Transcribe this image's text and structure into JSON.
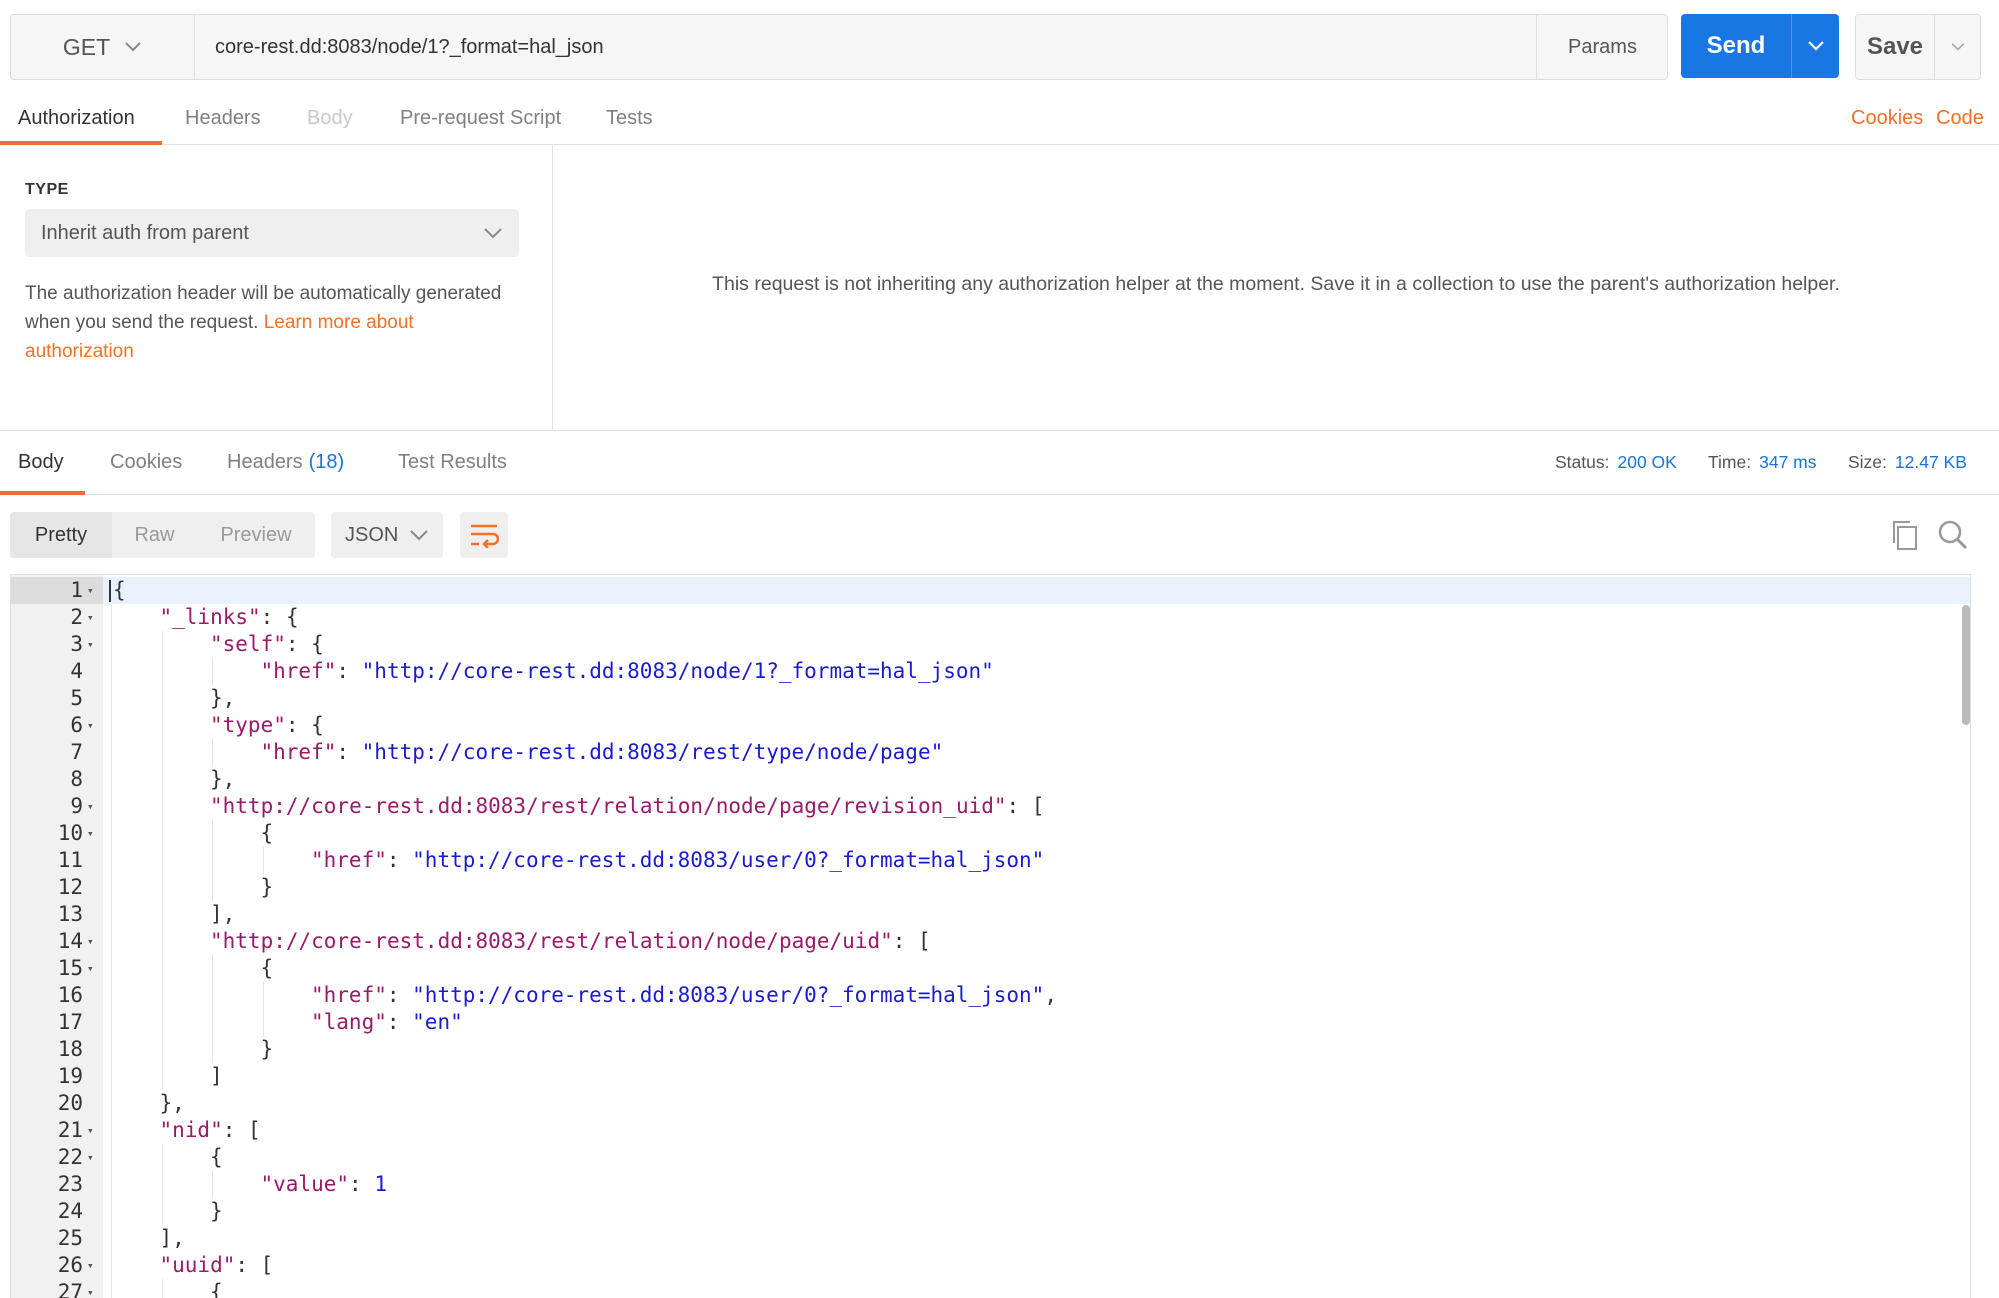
{
  "request": {
    "method": "GET",
    "url": "core-rest.dd:8083/node/1?_format=hal_json",
    "params_label": "Params",
    "send_label": "Send",
    "save_label": "Save"
  },
  "request_tabs": [
    {
      "label": "Authorization"
    },
    {
      "label": "Headers"
    },
    {
      "label": "Body"
    },
    {
      "label": "Pre-request Script"
    },
    {
      "label": "Tests"
    }
  ],
  "request_links": {
    "cookies": "Cookies",
    "code": "Code"
  },
  "auth": {
    "type_label": "TYPE",
    "type_value": "Inherit auth from parent",
    "description": "The authorization header will be automatically generated when you send the request.",
    "learn_more": "Learn more about authorization",
    "message": "This request is not inheriting any authorization helper at the moment. Save it in a collection to use the parent's authorization helper."
  },
  "response_tabs": [
    {
      "label": "Body"
    },
    {
      "label": "Cookies"
    },
    {
      "label": "Headers",
      "badge": "(18)"
    },
    {
      "label": "Test Results"
    }
  ],
  "status": {
    "status_label": "Status:",
    "status_value": "200 OK",
    "time_label": "Time:",
    "time_value": "347 ms",
    "size_label": "Size:",
    "size_value": "12.47 KB"
  },
  "body_view": {
    "modes": [
      "Pretty",
      "Raw",
      "Preview"
    ],
    "language": "JSON"
  },
  "icons": {
    "wrap": "wrap-lines-icon",
    "copy": "copy-icon",
    "search": "search-icon",
    "accent_color": "#f47023",
    "send_color": "#1877e3",
    "link_blue": "#1a73d9"
  },
  "code_lines": [
    {
      "n": "1",
      "fold": true,
      "indent": 0,
      "tokens": [
        {
          "t": "p",
          "v": "{"
        }
      ]
    },
    {
      "n": "2",
      "fold": true,
      "indent": 1,
      "tokens": [
        {
          "t": "k",
          "v": "\"_links\""
        },
        {
          "t": "p",
          "v": ": {"
        }
      ]
    },
    {
      "n": "3",
      "fold": true,
      "indent": 2,
      "tokens": [
        {
          "t": "k",
          "v": "\"self\""
        },
        {
          "t": "p",
          "v": ": {"
        }
      ]
    },
    {
      "n": "4",
      "fold": false,
      "indent": 3,
      "tokens": [
        {
          "t": "k",
          "v": "\"href\""
        },
        {
          "t": "p",
          "v": ": "
        },
        {
          "t": "s",
          "v": "\"http://core-rest.dd:8083/node/1?_format=hal_json\""
        }
      ]
    },
    {
      "n": "5",
      "fold": false,
      "indent": 2,
      "tokens": [
        {
          "t": "p",
          "v": "},"
        }
      ]
    },
    {
      "n": "6",
      "fold": true,
      "indent": 2,
      "tokens": [
        {
          "t": "k",
          "v": "\"type\""
        },
        {
          "t": "p",
          "v": ": {"
        }
      ]
    },
    {
      "n": "7",
      "fold": false,
      "indent": 3,
      "tokens": [
        {
          "t": "k",
          "v": "\"href\""
        },
        {
          "t": "p",
          "v": ": "
        },
        {
          "t": "s",
          "v": "\"http://core-rest.dd:8083/rest/type/node/page\""
        }
      ]
    },
    {
      "n": "8",
      "fold": false,
      "indent": 2,
      "tokens": [
        {
          "t": "p",
          "v": "},"
        }
      ]
    },
    {
      "n": "9",
      "fold": true,
      "indent": 2,
      "tokens": [
        {
          "t": "k",
          "v": "\"http://core-rest.dd:8083/rest/relation/node/page/revision_uid\""
        },
        {
          "t": "p",
          "v": ": ["
        }
      ]
    },
    {
      "n": "10",
      "fold": true,
      "indent": 3,
      "tokens": [
        {
          "t": "p",
          "v": "{"
        }
      ]
    },
    {
      "n": "11",
      "fold": false,
      "indent": 4,
      "tokens": [
        {
          "t": "k",
          "v": "\"href\""
        },
        {
          "t": "p",
          "v": ": "
        },
        {
          "t": "s",
          "v": "\"http://core-rest.dd:8083/user/0?_format=hal_json\""
        }
      ]
    },
    {
      "n": "12",
      "fold": false,
      "indent": 3,
      "tokens": [
        {
          "t": "p",
          "v": "}"
        }
      ]
    },
    {
      "n": "13",
      "fold": false,
      "indent": 2,
      "tokens": [
        {
          "t": "p",
          "v": "],"
        }
      ]
    },
    {
      "n": "14",
      "fold": true,
      "indent": 2,
      "tokens": [
        {
          "t": "k",
          "v": "\"http://core-rest.dd:8083/rest/relation/node/page/uid\""
        },
        {
          "t": "p",
          "v": ": ["
        }
      ]
    },
    {
      "n": "15",
      "fold": true,
      "indent": 3,
      "tokens": [
        {
          "t": "p",
          "v": "{"
        }
      ]
    },
    {
      "n": "16",
      "fold": false,
      "indent": 4,
      "tokens": [
        {
          "t": "k",
          "v": "\"href\""
        },
        {
          "t": "p",
          "v": ": "
        },
        {
          "t": "s",
          "v": "\"http://core-rest.dd:8083/user/0?_format=hal_json\""
        },
        {
          "t": "p",
          "v": ","
        }
      ]
    },
    {
      "n": "17",
      "fold": false,
      "indent": 4,
      "tokens": [
        {
          "t": "k",
          "v": "\"lang\""
        },
        {
          "t": "p",
          "v": ": "
        },
        {
          "t": "s",
          "v": "\"en\""
        }
      ]
    },
    {
      "n": "18",
      "fold": false,
      "indent": 3,
      "tokens": [
        {
          "t": "p",
          "v": "}"
        }
      ]
    },
    {
      "n": "19",
      "fold": false,
      "indent": 2,
      "tokens": [
        {
          "t": "p",
          "v": "]"
        }
      ]
    },
    {
      "n": "20",
      "fold": false,
      "indent": 1,
      "tokens": [
        {
          "t": "p",
          "v": "},"
        }
      ]
    },
    {
      "n": "21",
      "fold": true,
      "indent": 1,
      "tokens": [
        {
          "t": "k",
          "v": "\"nid\""
        },
        {
          "t": "p",
          "v": ": ["
        }
      ]
    },
    {
      "n": "22",
      "fold": true,
      "indent": 2,
      "tokens": [
        {
          "t": "p",
          "v": "{"
        }
      ]
    },
    {
      "n": "23",
      "fold": false,
      "indent": 3,
      "tokens": [
        {
          "t": "k",
          "v": "\"value\""
        },
        {
          "t": "p",
          "v": ": "
        },
        {
          "t": "n",
          "v": "1"
        }
      ]
    },
    {
      "n": "24",
      "fold": false,
      "indent": 2,
      "tokens": [
        {
          "t": "p",
          "v": "}"
        }
      ]
    },
    {
      "n": "25",
      "fold": false,
      "indent": 1,
      "tokens": [
        {
          "t": "p",
          "v": "],"
        }
      ]
    },
    {
      "n": "26",
      "fold": true,
      "indent": 1,
      "tokens": [
        {
          "t": "k",
          "v": "\"uuid\""
        },
        {
          "t": "p",
          "v": ": ["
        }
      ]
    },
    {
      "n": "27",
      "fold": true,
      "indent": 2,
      "tokens": [
        {
          "t": "p",
          "v": "{"
        }
      ]
    }
  ]
}
